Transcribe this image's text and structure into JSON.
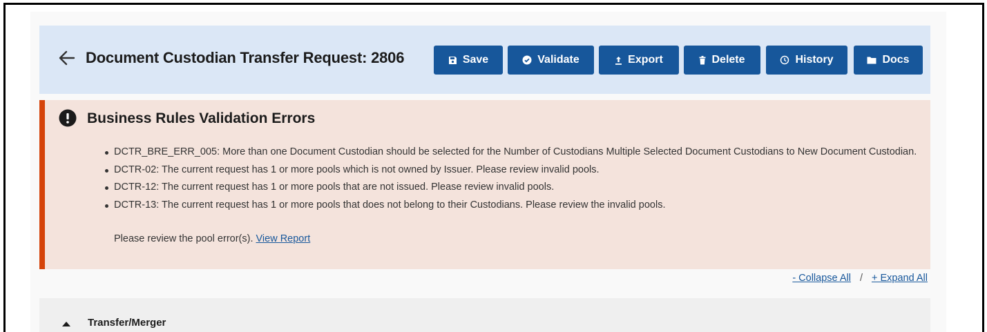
{
  "header": {
    "title": "Document Custodian Transfer Request: 2806",
    "back_icon": "arrow-left-icon",
    "buttons": [
      {
        "label": "Save",
        "icon": "save-icon"
      },
      {
        "label": "Validate",
        "icon": "check-circle-icon"
      },
      {
        "label": "Export",
        "icon": "upload-icon"
      },
      {
        "label": "Delete",
        "icon": "trash-icon"
      },
      {
        "label": "History",
        "icon": "history-icon"
      },
      {
        "label": "Docs",
        "icon": "folder-icon"
      }
    ]
  },
  "alert": {
    "icon": "exclamation-circle-icon",
    "title": "Business Rules Validation Errors",
    "errors": [
      "DCTR_BRE_ERR_005: More than one Document Custodian should be selected for the Number of Custodians Multiple Selected Document Custodians to New Document Custodian.",
      "DCTR-02: The current request has 1 or more pools which is not owned by Issuer. Please review invalid pools.",
      "DCTR-12: The current request has 1 or more pools that are not issued. Please review invalid pools.",
      "DCTR-13: The current request has 1 or more pools that does not belong to their Custodians. Please review the invalid pools."
    ],
    "note_text": "Please review the pool error(s).",
    "note_link": "View Report"
  },
  "toggles": {
    "collapse": "- Collapse All",
    "separator": "/",
    "expand": "+ Expand All"
  },
  "accordion": {
    "title": "Transfer/Merger",
    "caret_icon": "caret-up-icon"
  },
  "colors": {
    "primary": "#17579b",
    "header_bg": "#dbe7f6",
    "alert_bg": "#f4e3dc",
    "alert_border": "#d54309"
  }
}
